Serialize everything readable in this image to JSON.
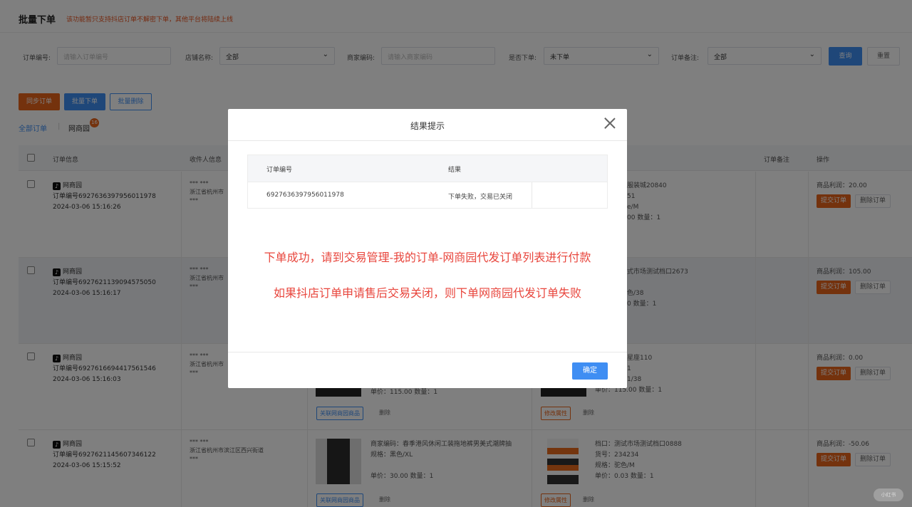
{
  "header": {
    "title": "批量下单",
    "notice": "该功能暂只支持抖店订单不解密下单，其他平台将陆续上线"
  },
  "filters": {
    "order_no_label": "订单编号:",
    "order_no_placeholder": "请输入订单编号",
    "shop_label": "店铺名称:",
    "shop_value": "全部",
    "merchant_code_label": "商家编码:",
    "merchant_code_placeholder": "请输入商家编码",
    "ordered_label": "是否下单:",
    "ordered_value": "未下单",
    "remark_label": "订单备注:",
    "remark_value": "全部",
    "search_btn": "查询",
    "reset_btn": "重置"
  },
  "actions": {
    "sync": "同步订单",
    "batch_order": "批量下单",
    "batch_delete": "批量删除"
  },
  "tabs": {
    "all": "全部订单",
    "sep": "|",
    "wsy": "网商园",
    "wsy_badge": "16"
  },
  "table": {
    "headers": {
      "order_info": "订单信息",
      "receiver": "收件人信息",
      "remark": "订单备注",
      "ops": "操作"
    },
    "rows": [
      {
        "shop": "网商园",
        "order_no": "订单编号6927636397956011978",
        "time": "2024-03-06 15:16:26",
        "receiver_name": "*** ***",
        "receiver_addr": "浙江省杭州市",
        "receiver_phone": "***",
        "right_line1": "服装城20840",
        "right_line2": "51",
        "right_line3": "e/M",
        "right_line4": "00 数量：1",
        "profit": "商品利润：20.00",
        "submit": "提交订单",
        "delete": "删除订单"
      },
      {
        "shop": "网商园",
        "order_no": "订单编号6927621139094575050",
        "time": "2024-03-06 15:16:17",
        "receiver_name": "*** ***",
        "receiver_addr": "浙江省杭州市",
        "receiver_phone": "***",
        "right_line1": "式市场测试档口2673",
        "right_line3": "色/38",
        "right_line4": "0 数量：1",
        "profit": "商品利润：105.00",
        "submit": "提交订单",
        "delete": "删除订单"
      },
      {
        "shop": "网商园",
        "order_no": "订单编号6927616694417561546",
        "time": "2024-03-06 15:16:03",
        "receiver_name": "*** ***",
        "receiver_addr": "浙江省杭州市",
        "receiver_phone": "***",
        "left_price": "单价：115.00 数量：1",
        "left_link": "关联网商园商品",
        "left_del": "删除",
        "right_line1": "星座110",
        "right_line2": "1",
        "right_line3": "1/38",
        "right_line4": "单价：115.00 数量：1",
        "right_btn": "修改属性",
        "right_del": "删除",
        "profit": "商品利润：0.00",
        "submit": "提交订单",
        "delete": "删除订单"
      },
      {
        "shop": "网商园",
        "order_no": "订单编号6927621145607346122",
        "time": "2024-03-06 15:15:52",
        "receiver_name": "*** ***",
        "receiver_addr": "浙江省杭州市滨江区西兴街道",
        "receiver_phone": "***",
        "left_code": "商家编码：春季港风休闲工装拖地裤男美式潮牌抽",
        "left_spec": "规格：黑色/XL",
        "left_price": "单价：30.00 数量：1",
        "left_link": "关联网商园商品",
        "left_del": "删除",
        "right_line1": "档口：测试市场测试档口0888",
        "right_line2": "货号：234234",
        "right_line3": "规格：驼色/M",
        "right_line4": "单价：0.03 数量：1",
        "right_btn": "修改属性",
        "right_del": "删除",
        "profit": "商品利润：-50.06",
        "submit": "提交订单",
        "delete": "删除订单"
      }
    ]
  },
  "modal": {
    "title": "结果提示",
    "col_order": "订单编号",
    "col_result": "结果",
    "row_order": "6927636397956011978",
    "row_result": "下单失败，交易已关闭",
    "msg1": "下单成功，请到交易管理-我的订单-网商园代发订单列表进行付款",
    "msg2": "如果抖店订单申请售后交易关闭，则下单网商园代发订单失败",
    "ok": "确定"
  },
  "corner_text": "小红书"
}
